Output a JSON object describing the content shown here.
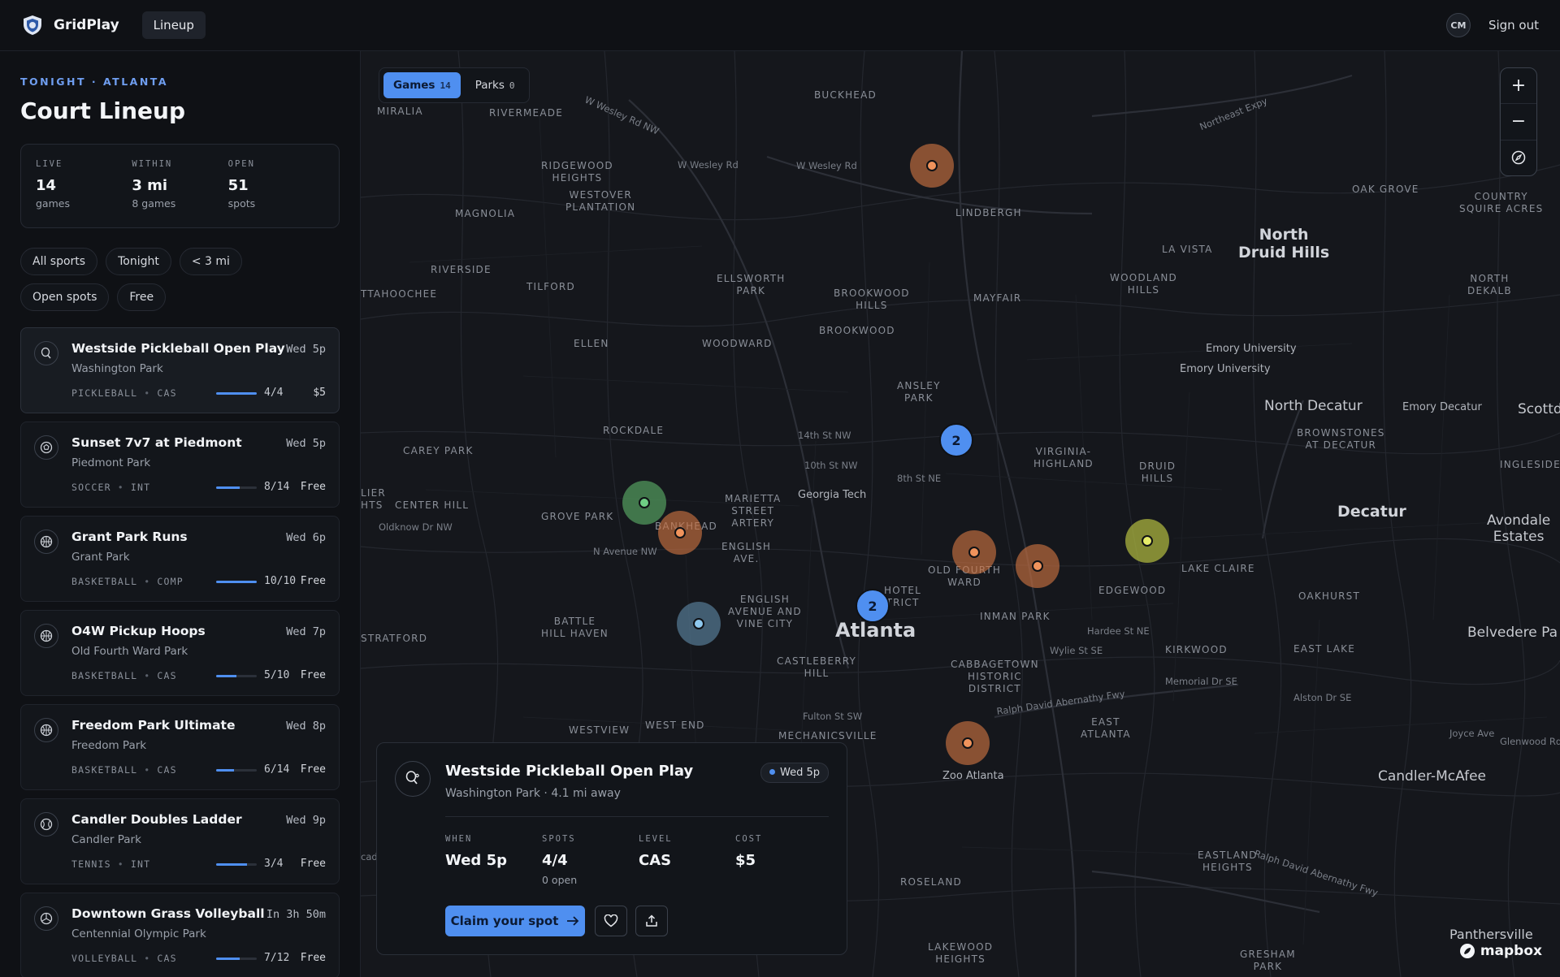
{
  "app": {
    "name": "GridPlay",
    "nav_item": "Lineup",
    "avatar_initials": "CM",
    "sign_out": "Sign out",
    "accent": "#4f8ff0"
  },
  "sidebar": {
    "eyebrow": "TONIGHT · ATLANTA",
    "title": "Court Lineup",
    "stats": [
      {
        "label": "LIVE",
        "value": "14",
        "sub": "games"
      },
      {
        "label": "WITHIN",
        "value": "3 mi",
        "sub": "8 games"
      },
      {
        "label": "OPEN",
        "value": "51",
        "sub": "spots"
      }
    ],
    "filters": [
      "All sports",
      "Tonight",
      "< 3 mi",
      "Open spots",
      "Free"
    ],
    "games": [
      {
        "title": "Westside Pickleball Open Play",
        "time": "Wed 5p",
        "park": "Washington Park",
        "sport": "PICKLEBALL",
        "level": "CAS",
        "spots": "4/4",
        "fill": 1.0,
        "cost": "$5",
        "icon": "pickleball-icon"
      },
      {
        "title": "Sunset 7v7 at Piedmont",
        "time": "Wed 5p",
        "park": "Piedmont Park",
        "sport": "SOCCER",
        "level": "INT",
        "spots": "8/14",
        "fill": 0.57,
        "cost": "Free",
        "icon": "soccer-ball-icon"
      },
      {
        "title": "Grant Park Runs",
        "time": "Wed 6p",
        "park": "Grant Park",
        "sport": "BASKETBALL",
        "level": "COMP",
        "spots": "10/10",
        "fill": 1.0,
        "cost": "Free",
        "icon": "basketball-icon"
      },
      {
        "title": "O4W Pickup Hoops",
        "time": "Wed 7p",
        "park": "Old Fourth Ward Park",
        "sport": "BASKETBALL",
        "level": "CAS",
        "spots": "5/10",
        "fill": 0.5,
        "cost": "Free",
        "icon": "basketball-icon"
      },
      {
        "title": "Freedom Park Ultimate",
        "time": "Wed 8p",
        "park": "Freedom Park",
        "sport": "BASKETBALL",
        "level": "CAS",
        "spots": "6/14",
        "fill": 0.43,
        "cost": "Free",
        "icon": "basketball-icon"
      },
      {
        "title": "Candler Doubles Ladder",
        "time": "Wed 9p",
        "park": "Candler Park",
        "sport": "TENNIS",
        "level": "INT",
        "spots": "3/4",
        "fill": 0.75,
        "cost": "Free",
        "icon": "tennis-ball-icon"
      },
      {
        "title": "Downtown Grass Volleyball",
        "time": "In 3h 50m",
        "park": "Centennial Olympic Park",
        "sport": "VOLLEYBALL",
        "level": "CAS",
        "spots": "7/12",
        "fill": 0.58,
        "cost": "Free",
        "icon": "volleyball-icon"
      }
    ]
  },
  "map": {
    "tabs": [
      {
        "label": "Games",
        "count": "14"
      },
      {
        "label": "Parks",
        "count": "0"
      }
    ],
    "cluster_counts": [
      "2",
      "2"
    ],
    "labels": {
      "atlanta": "Atlanta",
      "north_druid_hills": "North\nDruid Hills",
      "north_decatur": "North Decatur",
      "decatur": "Decatur",
      "avondale": "Avondale\nEstates",
      "candler_mcafee": "Candler-McAfee",
      "belvedere": "Belvedere Pa",
      "scottda": "Scottda",
      "panthersville": "Panthersville",
      "buckhead": "BUCKHEAD",
      "miralia": "MIRALIA",
      "rivermeade": "RIVERMEADE",
      "ridgewood": "RIDGEWOOD\nHEIGHTS",
      "westover": "WESTOVER\nPLANTATION",
      "magnolia": "MAGNOLIA",
      "lindbergh": "LINDBERGH",
      "la_vista": "LA VISTA",
      "oak_grove": "OAK GROVE",
      "country_squire": "COUNTRY\nSQUIRE ACRES",
      "riverside": "RIVERSIDE",
      "tilford": "TILFORD",
      "ellsworth": "ELLSWORTH\nPARK",
      "brookwood_hills": "BROOKWOOD\nHILLS",
      "mayfair": "MAYFAIR",
      "woodland_hills": "WOODLAND\nHILLS",
      "north_dekalb": "NORTH\nDEKALB",
      "chattahoochee": "TTAHOOCHEE",
      "ellen": "ELLEN",
      "woodward": "WOODWARD",
      "brookwood": "BROOKWOOD",
      "ansley": "ANSLEY\nPARK",
      "rockdale": "ROCKDALE",
      "carey_park": "CAREY PARK",
      "virginia_highland": "VIRGINIA-\nHIGHLAND",
      "druid_hills": "DRUID\nHILLS",
      "brownstones": "BROWNSTONES\nAT DECATUR",
      "ingleside": "INGLESIDE",
      "lier": "LIER\nHTS",
      "center_hill": "CENTER HILL",
      "grove_park": "GROVE PARK",
      "bankhead": "BANKHEAD",
      "marietta": "MARIETTA\nSTREET\nARTERY",
      "english_ave": "ENGLISH\nAVE.",
      "old_fourth_ward": "OLD FOURTH\nWARD",
      "lake_claire": "LAKE CLAIRE",
      "edgewood": "EDGEWOOD",
      "oakhurst": "OAKHURST",
      "english_avenue_vine": "ENGLISH\nAVENUE AND\nVINE CITY",
      "hotel_district": "HOTEL\nTRICT",
      "inman_park": "INMAN PARK",
      "battle_hill": "BATTLE\nHILL HAVEN",
      "stratford": "STRATFORD",
      "castleberry": "CASTLEBERRY\nHILL",
      "cabbagetown": "CABBAGETOWN\nHISTORIC\nDISTRICT",
      "kirkwood": "KIRKWOOD",
      "east_lake": "EAST LAKE",
      "westview": "WESTVIEW",
      "west_end": "WEST END",
      "mechanicsville": "MECHANICSVILLE",
      "east_atlanta": "EAST\nATLANTA",
      "eastland": "EASTLAND\nHEIGHTS",
      "roseland": "ROSELAND",
      "lakewood": "LAKEWOOD\nHEIGHTS",
      "gresham": "GRESHAM\nPARK",
      "emory1": "Emory University",
      "emory2": "Emory University",
      "emory_decatur": "Emory Decatur",
      "georgia_tech": "Georgia Tech",
      "zoo": "Zoo Atlanta",
      "w_wesley_1": "W Wesley Rd",
      "w_wesley_2": "W Wesley Rd",
      "w_wesley_nw": "W Wesley Rd NW",
      "northeast_expy": "Northeast Expy",
      "st14": "14th St NW",
      "st10": "10th St NW",
      "st8": "8th St NE",
      "oldknow": "Oldknow Dr NW",
      "n_avenue": "N Avenue NW",
      "hardee": "Hardee St NE",
      "wylie": "Wylie St SE",
      "memorial": "Memorial Dr SE",
      "alston": "Alston Dr SE",
      "joyce": "Joyce Ave",
      "glenwood": "Glenwood Rd",
      "ralph_david": "Ralph David Abernathy Fwy",
      "fulton": "Fulton St SW",
      "ralph_david_2": "Ralph David Abernathy Fwy",
      "cad": "cad"
    },
    "zoom_in": "+",
    "zoom_out": "−",
    "attribution": "mapbox"
  },
  "detail": {
    "title": "Westside Pickleball Open Play",
    "subtitle": "Washington Park · 4.1 mi away",
    "badge": "Wed 5p",
    "cols": [
      {
        "label": "WHEN",
        "value": "Wed 5p",
        "sub": ""
      },
      {
        "label": "SPOTS",
        "value": "4/4",
        "sub": "0 open"
      },
      {
        "label": "LEVEL",
        "value": "CAS",
        "sub": ""
      },
      {
        "label": "COST",
        "value": "$5",
        "sub": ""
      }
    ],
    "cta": "Claim your spot"
  }
}
